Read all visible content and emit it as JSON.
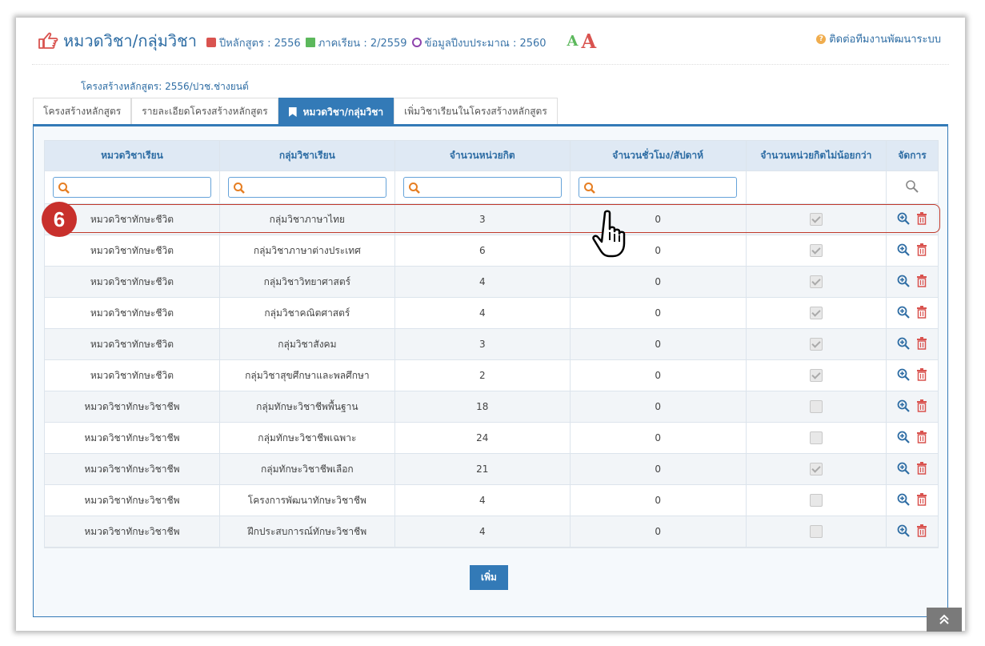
{
  "header": {
    "title": "หมวดวิชา/กลุ่มวิชา",
    "curriculum_year": "ปีหลักสูตร : 2556",
    "semester": "ภาคเรียน : 2/2559",
    "budget_year": "ข้อมูลปีงบประมาณ : 2560",
    "font_small": "A",
    "font_large": "A",
    "contact": "ติดต่อทีมงานพัฒนาระบบ"
  },
  "structure_label": "โครงสร้างหลักสูตร: 2556/ปวช.ช่างยนต์",
  "tabs": [
    {
      "label": "โครงสร้างหลักสูตร"
    },
    {
      "label": "รายละเอียดโครงสร้างหลักสูตร"
    },
    {
      "label": "หมวดวิชา/กลุ่มวิชา"
    },
    {
      "label": "เพิ่มวิชาเรียนในโครงสร้างหลักสูตร"
    }
  ],
  "table": {
    "columns": [
      "หมวดวิชาเรียน",
      "กลุ่มวิชาเรียน",
      "จำนวนหน่วยกิต",
      "จำนวนชั่วโมง/สัปดาห์",
      "จำนวนหน่วยกิตไม่น้อยกว่า",
      "จัดการ"
    ],
    "rows": [
      {
        "category": "หมวดวิชาทักษะชีวิต",
        "group": "กลุ่มวิชาภาษาไทย",
        "credits": "3",
        "hours": "0",
        "min_checked": true
      },
      {
        "category": "หมวดวิชาทักษะชีวิต",
        "group": "กลุ่มวิชาภาษาต่างประเทศ",
        "credits": "6",
        "hours": "0",
        "min_checked": true
      },
      {
        "category": "หมวดวิชาทักษะชีวิต",
        "group": "กลุ่มวิชาวิทยาศาสตร์",
        "credits": "4",
        "hours": "0",
        "min_checked": true
      },
      {
        "category": "หมวดวิชาทักษะชีวิต",
        "group": "กลุ่มวิชาคณิตศาสตร์",
        "credits": "4",
        "hours": "0",
        "min_checked": true
      },
      {
        "category": "หมวดวิชาทักษะชีวิต",
        "group": "กลุ่มวิชาสังคม",
        "credits": "3",
        "hours": "0",
        "min_checked": true
      },
      {
        "category": "หมวดวิชาทักษะชีวิต",
        "group": "กลุ่มวิชาสุขศึกษาและพลศึกษา",
        "credits": "2",
        "hours": "0",
        "min_checked": true
      },
      {
        "category": "หมวดวิชาทักษะวิชาชีพ",
        "group": "กลุ่มทักษะวิชาชีพพื้นฐาน",
        "credits": "18",
        "hours": "0",
        "min_checked": false
      },
      {
        "category": "หมวดวิชาทักษะวิชาชีพ",
        "group": "กลุ่มทักษะวิชาชีพเฉพาะ",
        "credits": "24",
        "hours": "0",
        "min_checked": false
      },
      {
        "category": "หมวดวิชาทักษะวิชาชีพ",
        "group": "กลุ่มทักษะวิชาชีพเลือก",
        "credits": "21",
        "hours": "0",
        "min_checked": true
      },
      {
        "category": "หมวดวิชาทักษะวิชาชีพ",
        "group": "โครงการพัฒนาทักษะวิชาชีพ",
        "credits": "4",
        "hours": "0",
        "min_checked": false
      },
      {
        "category": "หมวดวิชาทักษะวิชาชีพ",
        "group": "ฝึกประสบการณ์ทักษะวิชาชีพ",
        "credits": "4",
        "hours": "0",
        "min_checked": false
      }
    ]
  },
  "add_button": "เพิ่ม",
  "step_badge": "6",
  "scroll_top_icon": "double-chevron-up-icon",
  "colors": {
    "primary": "#337ab7",
    "danger": "#d9534f",
    "highlight": "#c0392b",
    "search": "#e67e22"
  }
}
